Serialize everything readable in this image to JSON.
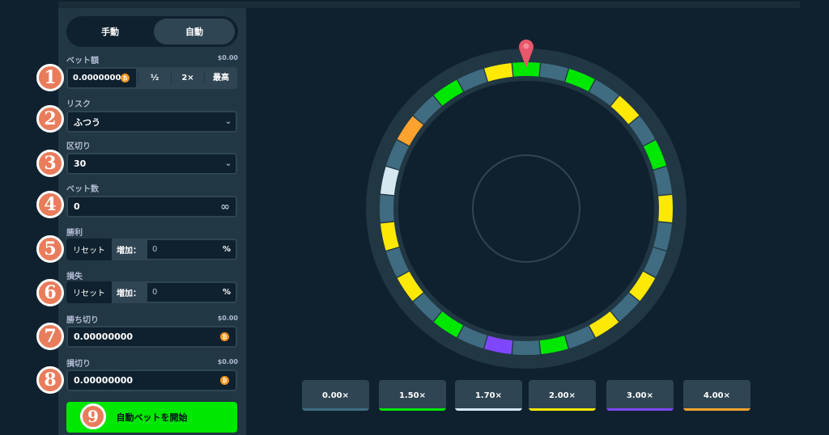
{
  "tabs": {
    "manual": "手動",
    "auto": "自動"
  },
  "bet": {
    "label": "ベット額",
    "amount_usd": "$0.00",
    "value": "0.00000000",
    "half": "½",
    "double": "2×",
    "max": "最高",
    "currency_glyph": "₿"
  },
  "risk": {
    "label": "リスク",
    "value": "ふつう"
  },
  "segments": {
    "label": "区切り",
    "value": "30"
  },
  "num_bets": {
    "label": "ベット数",
    "value": "0",
    "infinity": "∞"
  },
  "on_win": {
    "label": "勝利",
    "reset": "リセット",
    "increase": "増加：",
    "value": "0",
    "percent": "%"
  },
  "on_loss": {
    "label": "損失",
    "reset": "リセット",
    "increase": "増加：",
    "value": "0",
    "percent": "%"
  },
  "stop_profit": {
    "label": "勝ち切り",
    "amount_usd": "$0.00",
    "value": "0.00000000"
  },
  "stop_loss": {
    "label": "損切り",
    "amount_usd": "$0.00",
    "value": "0.00000000"
  },
  "start_button": "自動ベットを開始",
  "badges": [
    "1",
    "2",
    "3",
    "4",
    "5",
    "6",
    "7",
    "8",
    "9"
  ],
  "colors": {
    "green": "#00e701",
    "yellow": "#fde905",
    "white": "#d5e8f2",
    "purple": "#7f47fd",
    "orange": "#fca32f",
    "gray": "#406c82",
    "badge": "#e97c5b",
    "pointer": "#e9576c"
  },
  "wheel": {
    "segment_colors": [
      "green",
      "gray",
      "green",
      "gray",
      "yellow",
      "gray",
      "green",
      "gray",
      "yellow",
      "gray",
      "gray",
      "yellow",
      "gray",
      "yellow",
      "gray",
      "green",
      "gray",
      "purple",
      "gray",
      "green",
      "gray",
      "yellow",
      "gray",
      "yellow",
      "gray",
      "white",
      "gray",
      "orange",
      "gray",
      "green",
      "gray",
      "yellow"
    ]
  },
  "multipliers": [
    {
      "label": "0.00×",
      "color": "gray"
    },
    {
      "label": "1.50×",
      "color": "green"
    },
    {
      "label": "1.70×",
      "color": "white"
    },
    {
      "label": "2.00×",
      "color": "yellow"
    },
    {
      "label": "3.00×",
      "color": "purple"
    },
    {
      "label": "4.00×",
      "color": "orange"
    }
  ]
}
